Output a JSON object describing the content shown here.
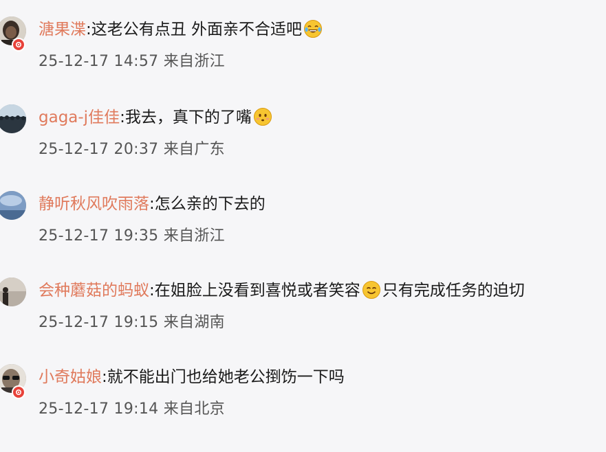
{
  "colors": {
    "username": "#e07a5c",
    "text": "#1a1a1a",
    "meta": "#555555",
    "badge": "#e8423a",
    "background": "#f6f6f8"
  },
  "comments": [
    {
      "username": "溏果渫",
      "colon": ":",
      "text_before_emoji": "这老公有点丑 外面亲不合适吧",
      "emoji": "laughing-tears-emoji",
      "text_after_emoji": "",
      "meta": "25-12-17 14:57 来自浙江",
      "avatar": "dark-portrait-avatar",
      "verified_badge": true
    },
    {
      "username": "gaga-j佳佳",
      "colon": ":",
      "text_before_emoji": "我去，真下的了嘴",
      "emoji": "shy-smile-emoji",
      "text_after_emoji": "",
      "meta": "25-12-17 20:37 来自广东",
      "avatar": "crowd-sky-avatar",
      "verified_badge": false
    },
    {
      "username": "静听秋风吹雨落",
      "colon": ":",
      "text_before_emoji": "怎么亲的下去的",
      "emoji": "",
      "text_after_emoji": "",
      "meta": "25-12-17 19:35 来自浙江",
      "avatar": "blue-sky-avatar",
      "verified_badge": false
    },
    {
      "username": "会种蘑菇的蚂蚁",
      "colon": ":",
      "text_before_emoji": "在姐脸上没看到喜悦或者笑容",
      "emoji": "smile-emoji",
      "text_after_emoji": "只有完成任务的迫切",
      "meta": "25-12-17 19:15 来自湖南",
      "avatar": "silhouette-avatar",
      "verified_badge": false
    },
    {
      "username": "小奇姑娘",
      "colon": ":",
      "text_before_emoji": "就不能出门也给她老公捯饬一下吗",
      "emoji": "",
      "text_after_emoji": "",
      "meta": "25-12-17 19:14 来自北京",
      "avatar": "sunglasses-avatar",
      "verified_badge": true
    }
  ]
}
